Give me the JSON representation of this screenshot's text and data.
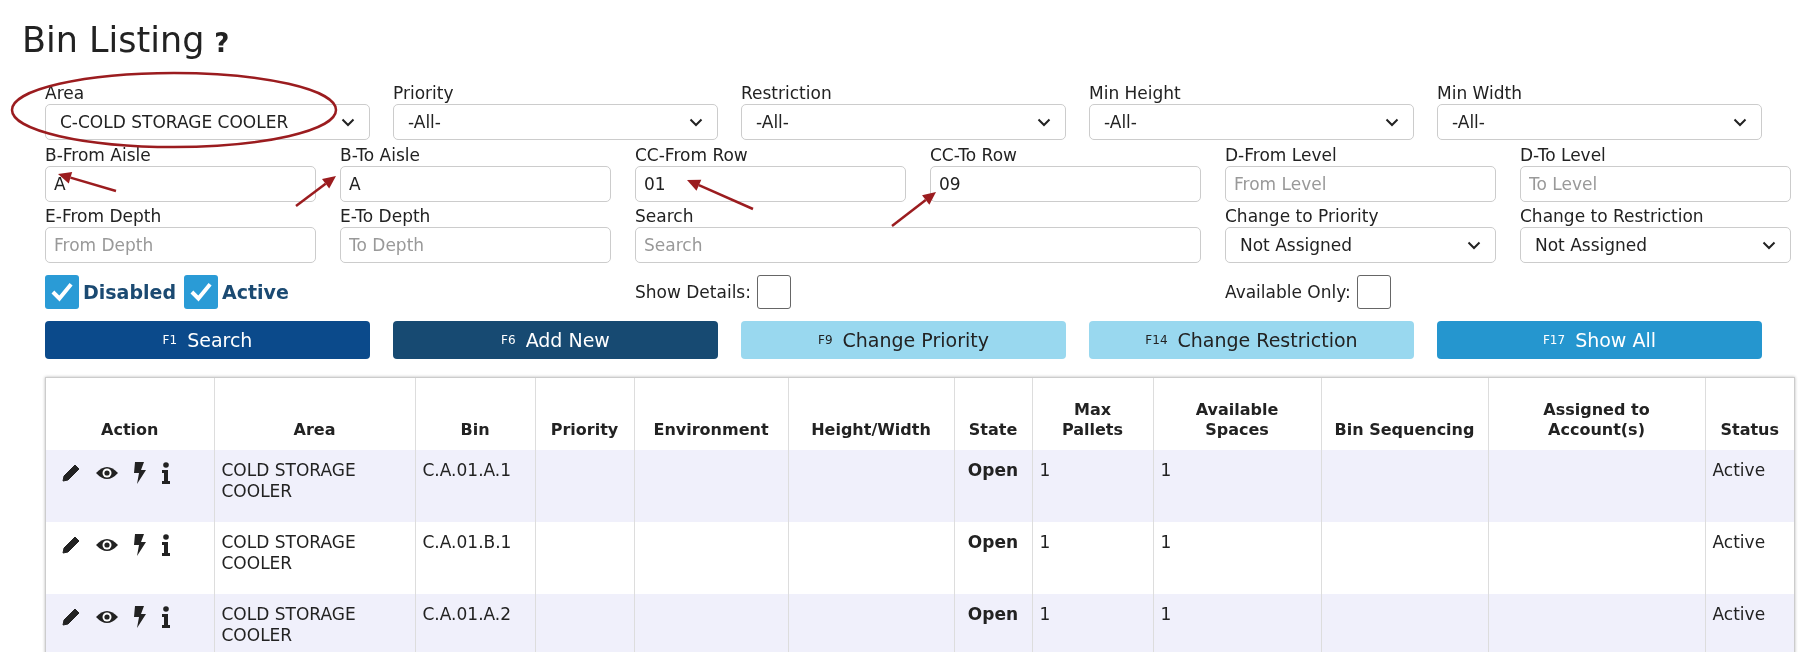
{
  "page": {
    "title": "Bin Listing",
    "help": "?"
  },
  "filter_row_1": [
    {
      "label": "Area",
      "kind": "select",
      "value": "C-COLD STORAGE COOLER"
    },
    {
      "label": "Priority",
      "kind": "select",
      "value": "-All-"
    },
    {
      "label": "Restriction",
      "kind": "select",
      "value": "-All-"
    },
    {
      "label": "Min Height",
      "kind": "select",
      "value": "-All-"
    },
    {
      "label": "Min Width",
      "kind": "select",
      "value": "-All-"
    }
  ],
  "filter_row_2": [
    {
      "label": "B-From Aisle",
      "kind": "input",
      "value": "A"
    },
    {
      "label": "B-To Aisle",
      "kind": "input",
      "value": "A"
    },
    {
      "label": "CC-From Row",
      "kind": "input",
      "value": "01"
    },
    {
      "label": "CC-To Row",
      "kind": "input",
      "value": "09"
    },
    {
      "label": "D-From Level",
      "kind": "input",
      "placeholder": "From Level"
    },
    {
      "label": "D-To Level",
      "kind": "input",
      "placeholder": "To Level"
    }
  ],
  "filter_row_3": [
    {
      "label": "E-From Depth",
      "kind": "input",
      "placeholder": "From Depth"
    },
    {
      "label": "E-To Depth",
      "kind": "input",
      "placeholder": "To Depth"
    },
    {
      "label": "Search",
      "kind": "search",
      "placeholder": "Search"
    },
    {
      "label": "Change to Priority",
      "kind": "select",
      "value": "Not Assigned"
    },
    {
      "label": "Change to Restriction",
      "kind": "select",
      "value": "Not Assigned"
    }
  ],
  "status_checks": [
    {
      "label": "Disabled",
      "checked": true
    },
    {
      "label": "Active",
      "checked": true
    }
  ],
  "show_details": {
    "label": "Show Details:",
    "checked": false
  },
  "available_only": {
    "label": "Available Only:",
    "checked": false
  },
  "buttons": [
    {
      "key": "F1",
      "label": "Search",
      "kind": "primary"
    },
    {
      "key": "F6",
      "label": "Add New",
      "kind": "dark"
    },
    {
      "key": "F9",
      "label": "Change Priority",
      "kind": "light"
    },
    {
      "key": "F14",
      "label": "Change Restriction",
      "kind": "light"
    },
    {
      "key": "F17",
      "label": "Show All",
      "kind": "info"
    }
  ],
  "table": {
    "columns": [
      "Action",
      "Area",
      "Bin",
      "Priority",
      "Environment",
      "Height/Width",
      "State",
      "Max Pallets",
      "Available Spaces",
      "Bin Sequencing",
      "Assigned to Account(s)",
      "Status"
    ],
    "rows": [
      {
        "area": "COLD STORAGE COOLER",
        "bin": "C.A.01.A.1",
        "state": "Open",
        "max_pallets": "1",
        "available_spaces": "1",
        "status": "Active"
      },
      {
        "area": "COLD STORAGE COOLER",
        "bin": "C.A.01.B.1",
        "state": "Open",
        "max_pallets": "1",
        "available_spaces": "1",
        "status": "Active"
      },
      {
        "area": "COLD STORAGE COOLER",
        "bin": "C.A.01.A.2",
        "state": "Open",
        "max_pallets": "1",
        "available_spaces": "1",
        "status": "Active"
      }
    ]
  }
}
